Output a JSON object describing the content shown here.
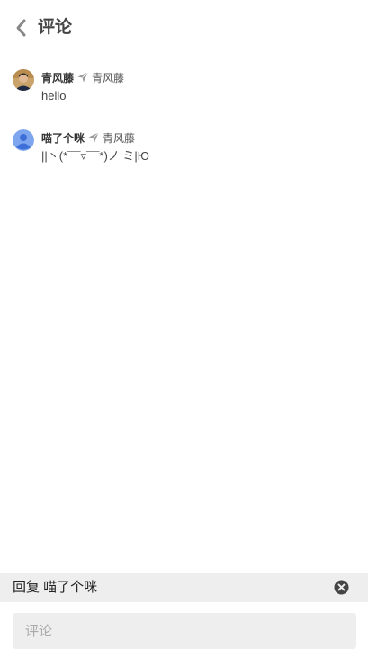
{
  "header": {
    "title": "评论",
    "back_icon": "chevron-left-icon"
  },
  "comments": [
    {
      "author": "青风藤",
      "reply_to": "青风藤",
      "content": "hello",
      "avatar": "photo-avatar"
    },
    {
      "author": "喵了个咪",
      "reply_to": "青风藤",
      "content": "||丶(*¯¯▿¯¯*)ノ ミ|Ю",
      "avatar": "default-user-avatar"
    }
  ],
  "reply_bar": {
    "label": "回复 喵了个咪",
    "clear_icon": "close-circle-icon"
  },
  "comment_input": {
    "placeholder": "评论",
    "value": ""
  },
  "colors": {
    "title": "#444444",
    "reply_bar_bg": "#eeeeee",
    "input_bg": "#eeeeee",
    "placeholder": "#aaaaaa",
    "default_avatar": "#7ea6ee"
  }
}
